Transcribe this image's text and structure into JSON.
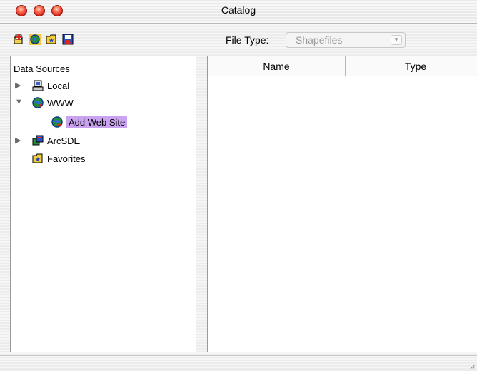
{
  "window": {
    "title": "Catalog"
  },
  "toolbar": {
    "icons": [
      "add-data-icon",
      "add-web-site-icon",
      "favorites-folder-icon",
      "save-icon"
    ],
    "file_type_label": "File Type:",
    "file_type_value": "Shapefiles"
  },
  "tree": {
    "title": "Data Sources",
    "items": [
      {
        "label": "Local",
        "icon": "computer-icon",
        "expanded": false,
        "level": 0
      },
      {
        "label": "WWW",
        "icon": "globe-icon",
        "expanded": true,
        "level": 0
      },
      {
        "label": "Add Web Site",
        "icon": "globe-icon",
        "selected": true,
        "level": 1
      },
      {
        "label": "ArcSDE",
        "icon": "database-server-icon",
        "expanded": false,
        "level": 0
      },
      {
        "label": "Favorites",
        "icon": "favorites-folder-icon",
        "level": 0
      }
    ]
  },
  "list": {
    "columns": [
      "Name",
      "Type"
    ],
    "rows": []
  },
  "colors": {
    "selection": "#c9a2f0",
    "close_button": "#e0372a"
  }
}
